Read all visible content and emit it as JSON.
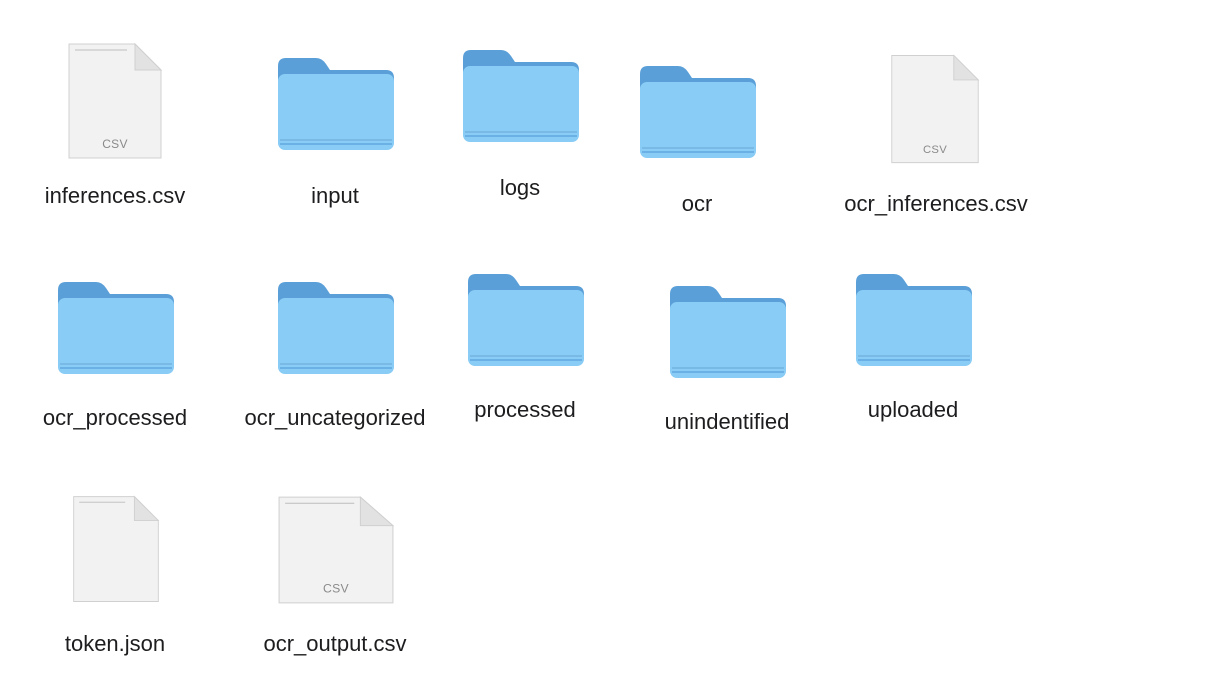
{
  "items": [
    {
      "name": "inferences.csv",
      "kind": "document",
      "badge": "CSV"
    },
    {
      "name": "input",
      "kind": "folder"
    },
    {
      "name": "logs",
      "kind": "folder"
    },
    {
      "name": "ocr",
      "kind": "folder"
    },
    {
      "name": "ocr_inferences.csv",
      "kind": "document",
      "badge": "CSV"
    },
    {
      "name": "ocr_processed",
      "kind": "folder"
    },
    {
      "name": "ocr_uncategorized",
      "kind": "folder"
    },
    {
      "name": "processed",
      "kind": "folder"
    },
    {
      "name": "unindentified",
      "kind": "folder"
    },
    {
      "name": "uploaded",
      "kind": "folder"
    },
    {
      "name": "token.json",
      "kind": "document",
      "badge": ""
    },
    {
      "name": "ocr_output.csv",
      "kind": "document",
      "badge": "CSV"
    }
  ],
  "colors": {
    "folder_front": "#89ccf5",
    "folder_back": "#5a9fd8",
    "folder_edge": "#6cb1e6",
    "document_paper": "#f4f4f4",
    "label_text": "#1d1d1f"
  }
}
